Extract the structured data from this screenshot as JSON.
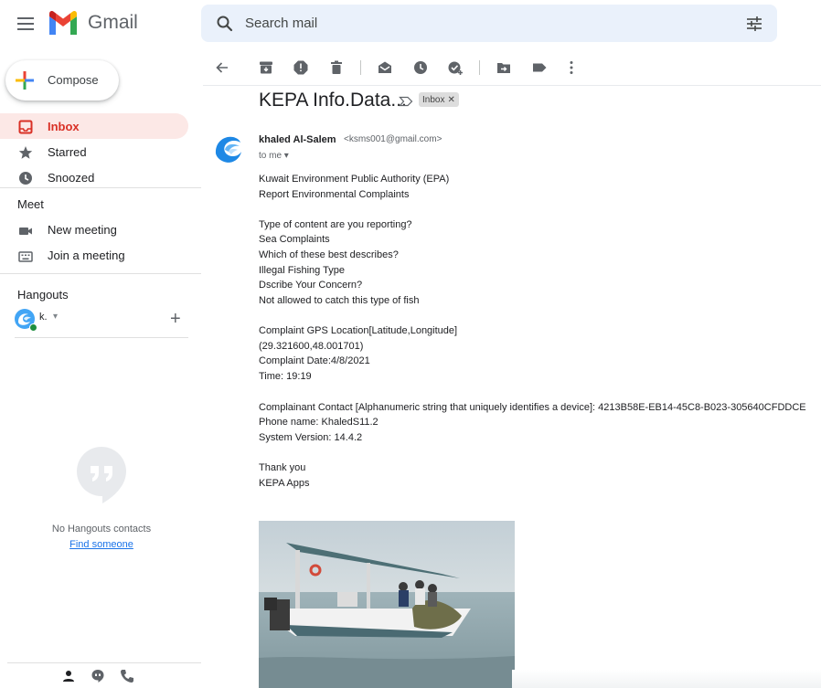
{
  "header": {
    "app_name": "Gmail",
    "search_placeholder": "Search mail",
    "icons": [
      "hamburger-menu-icon",
      "gmail-logo",
      "search-icon",
      "search-options-icon"
    ]
  },
  "sidebar": {
    "compose_label": "Compose",
    "items": [
      {
        "label": "Inbox",
        "icon": "inbox-icon",
        "active": true
      },
      {
        "label": "Starred",
        "icon": "star-icon",
        "active": false
      },
      {
        "label": "Snoozed",
        "icon": "clock-icon",
        "active": false
      }
    ],
    "meet": {
      "title": "Meet",
      "items": [
        {
          "label": "New meeting",
          "icon": "video-camera-icon"
        },
        {
          "label": "Join a meeting",
          "icon": "keyboard-icon"
        }
      ]
    },
    "hangouts": {
      "title": "Hangouts",
      "user_label": "k.",
      "no_contacts": "No Hangouts contacts",
      "find_someone": "Find someone"
    },
    "bottom_icons": [
      "person-icon",
      "hangouts-chat-icon",
      "phone-icon"
    ]
  },
  "toolbar": {
    "icons": [
      "back-arrow-icon",
      "archive-icon",
      "report-spam-icon",
      "delete-icon",
      "mark-unread-icon",
      "snooze-icon",
      "add-task-icon",
      "move-to-icon",
      "label-icon",
      "more-vert-icon"
    ]
  },
  "message": {
    "subject": "KEPA Info.Data...",
    "label": "Inbox",
    "sender_name": "khaled Al-Salem",
    "sender_email": "<ksms001@gmail.com>",
    "to": "to me",
    "body_lines": [
      "Kuwait Environment Public Authority (EPA)",
      "Report Environmental Complaints",
      "Type of content are you reporting?",
      "Sea Complaints",
      "Which of these best describes?",
      "Illegal Fishing Type",
      "Dscribe Your Concern?",
      "Not allowed to catch this type of fish",
      "Complaint GPS Location[Latitude,Longitude]",
      "(29.321600,48.001701)",
      "Complaint Date:4/8/2021",
      "Time: 19:19",
      "Complainant Contact [Alphanumeric string that uniquely identifies a device]: 4213B58E-EB14-45C8-B023-305640CFDDCE",
      "Phone name: KhaledS11.2",
      "System Version: 14.4.2",
      "Thank you",
      "KEPA Apps"
    ]
  },
  "colors": {
    "accent_red": "#d93025",
    "active_bg": "#fce8e6",
    "search_bg": "#eaf1fb",
    "link_blue": "#1a73e8",
    "avatar_blue": "#1e88e5"
  }
}
